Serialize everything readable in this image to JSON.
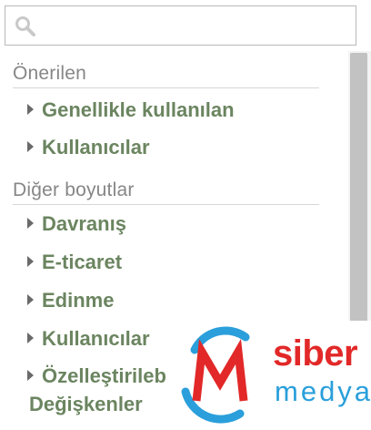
{
  "search": {
    "placeholder": "",
    "value": ""
  },
  "sections": [
    {
      "title": "Önerilen",
      "items": [
        "Genellikle kullanılan",
        "Kullanıcılar"
      ]
    },
    {
      "title": "Diğer boyutlar",
      "items": [
        "Davranış",
        "E-ticaret",
        "Edinme",
        "Kullanıcılar",
        "Özelleştirileb"
      ]
    }
  ],
  "wrapped_line": "Değişkenler",
  "logo": {
    "line1": "siber",
    "line2": "medya"
  },
  "colors": {
    "item_text": "#6b8560",
    "section_text": "#868686",
    "logo_red": "#e22828",
    "logo_blue": "#2a9fdb"
  },
  "icons": {
    "search": "search-icon",
    "expander": "triangle-right-icon"
  }
}
